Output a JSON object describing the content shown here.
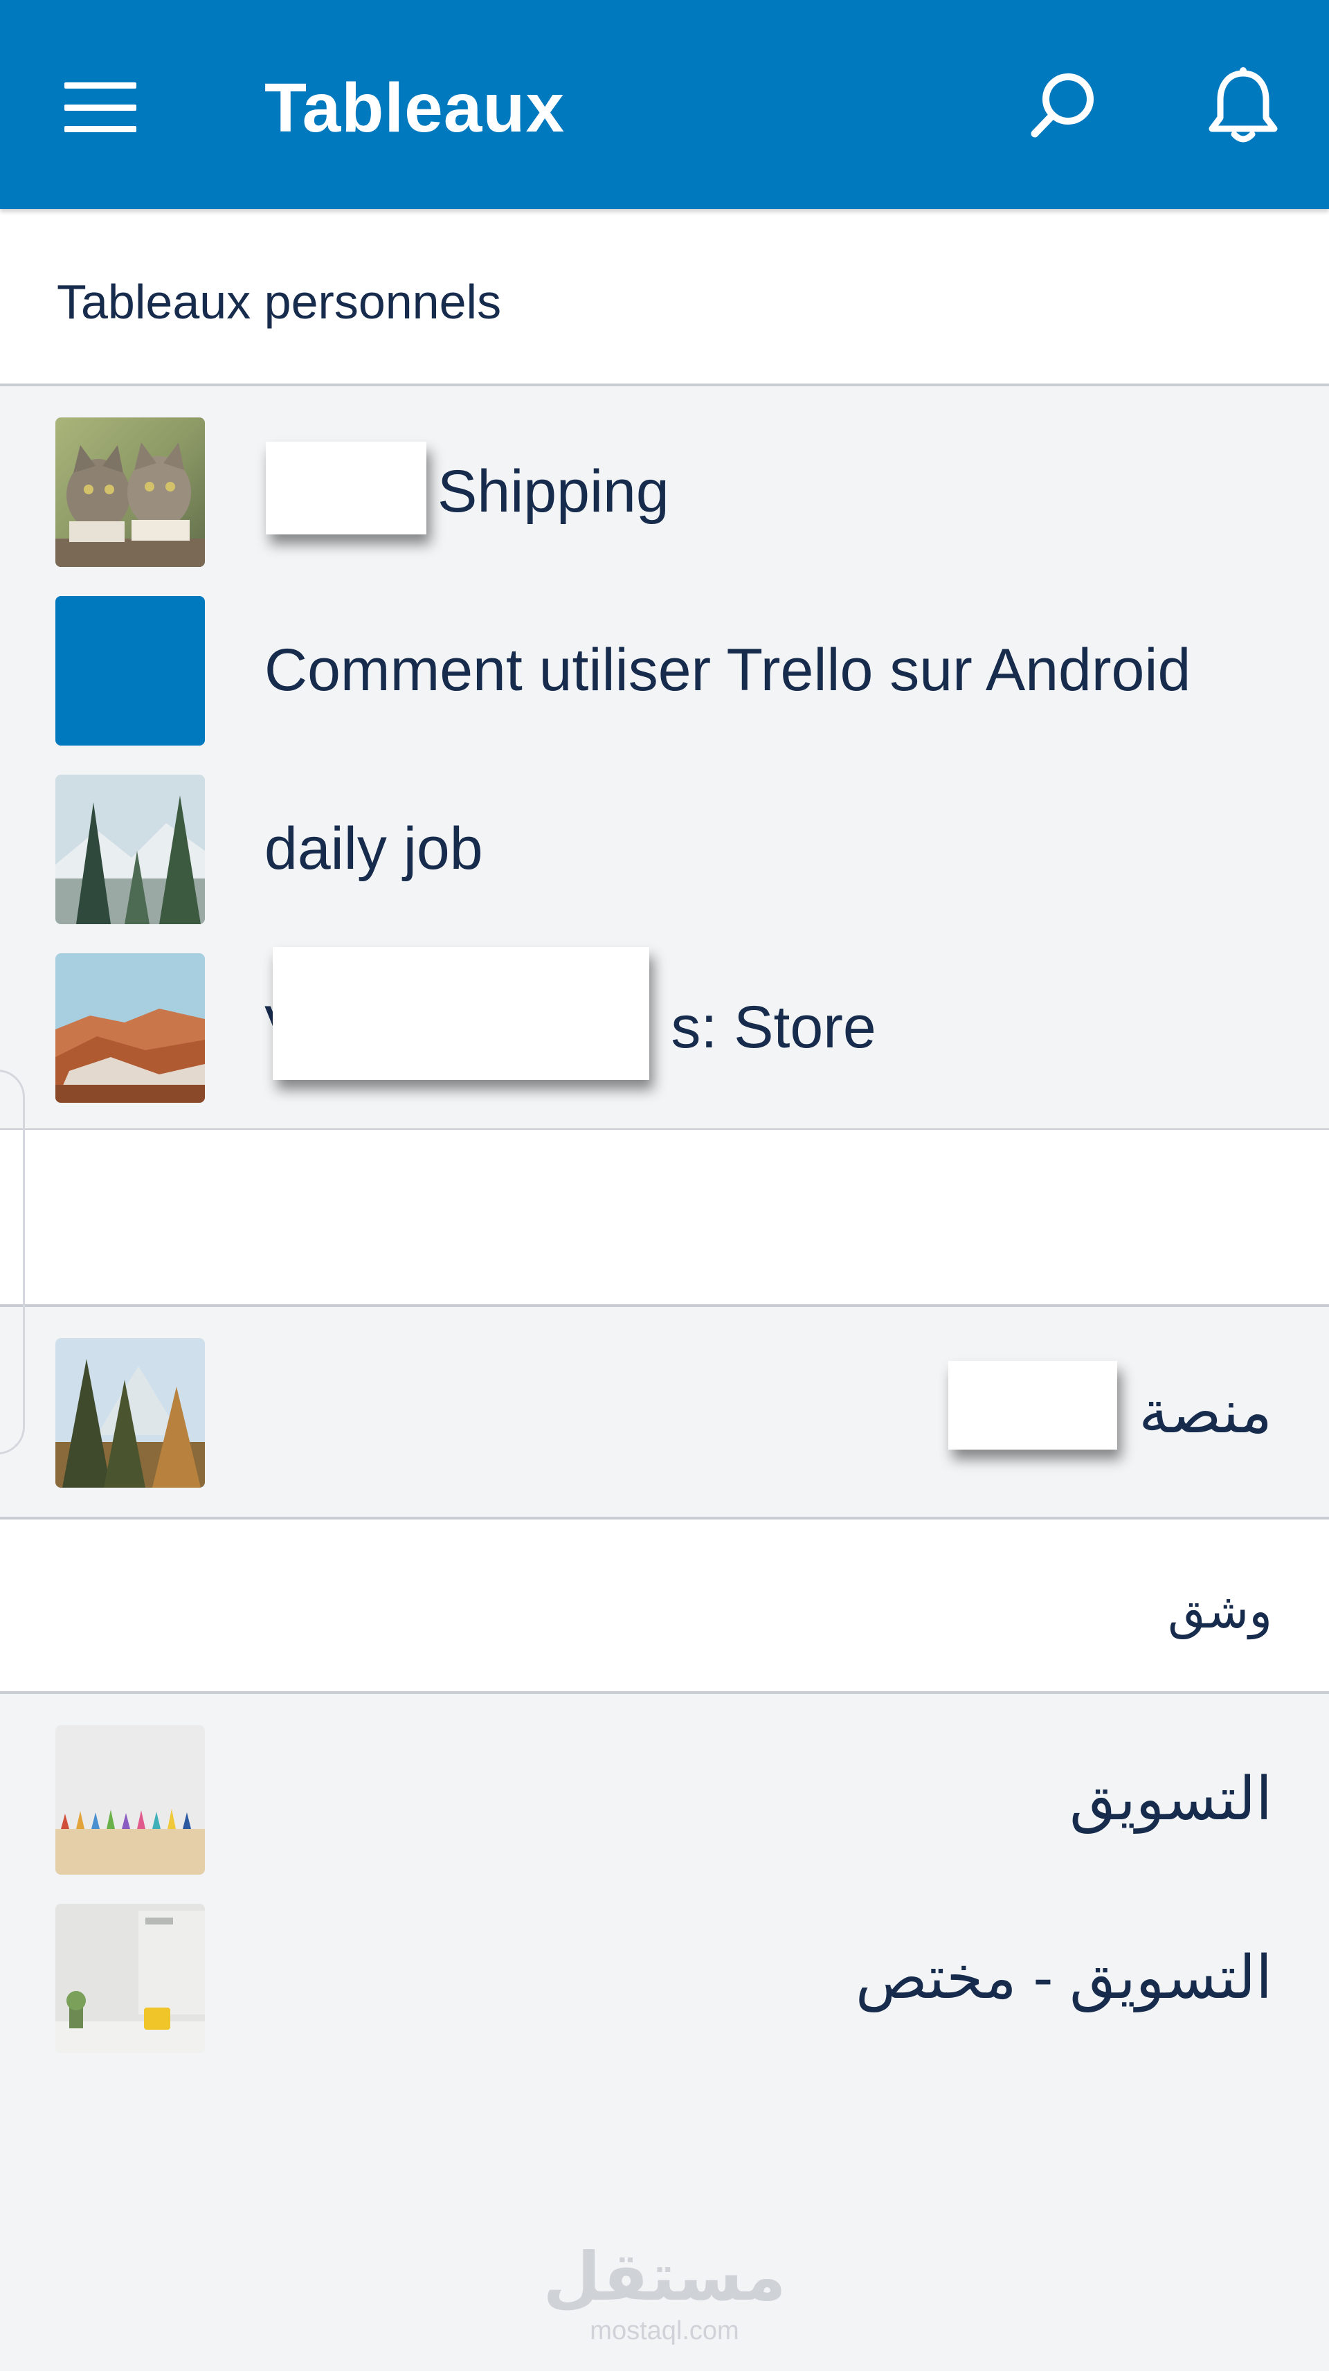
{
  "app_bar": {
    "title": "Tableaux",
    "menu_icon": "hamburger-menu-icon",
    "search_icon": "search-icon",
    "notifications_icon": "bell-icon",
    "background_color": "#0079bf"
  },
  "sections": {
    "personal": {
      "label": "Tableaux personnels"
    },
    "workspace_blank": {
      "label": ""
    },
    "workspace_wshq": {
      "label": "وشق"
    }
  },
  "boards": [
    {
      "title": "Shipping",
      "thumbnail": "cats-photo"
    },
    {
      "title": "Comment utiliser Trello sur Android",
      "thumbnail": "solid-blue",
      "color": "#0079bf"
    },
    {
      "title": "daily job",
      "thumbnail": "snowy-forest-photo"
    },
    {
      "title": "s: Store",
      "thumbnail": "canyon-photo",
      "prefix": "V"
    },
    {
      "title": "منصة ك",
      "thumbnail": "autumn-forest-photo"
    },
    {
      "title": "التسويق",
      "thumbnail": "pencils-photo"
    },
    {
      "title": "التسويق - مختص",
      "thumbnail": "desk-photo"
    }
  ],
  "watermark": {
    "main": "مستقل",
    "sub": "mostaql.com"
  }
}
